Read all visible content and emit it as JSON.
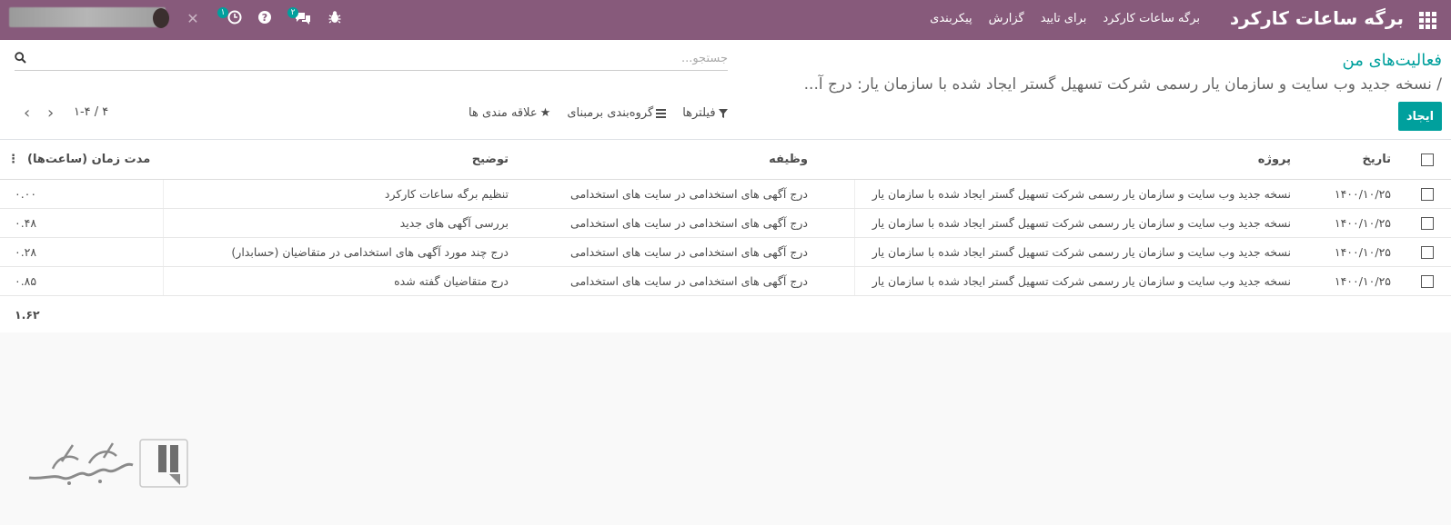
{
  "navbar": {
    "brand": "برگه ساعات کارکرد",
    "menu": [
      "برگه ساعات کارکرد",
      "برای تایید",
      "گزارش",
      "پیکربندی"
    ],
    "activity_badge": "۱",
    "messages_badge": "۲",
    "icons": [
      "apps-icon",
      "bug-icon",
      "chat-icon",
      "help-icon",
      "clock-icon",
      "close-icon"
    ]
  },
  "breadcrumb": {
    "parent": "فعالیت‌های من",
    "current": "/ نسخه جدید وب سایت و سازمان یار رسمی شرکت تسهیل گستر ایجاد شده با سازمان یار: درج آ..."
  },
  "search": {
    "placeholder": "جستجو..."
  },
  "toolbar": {
    "create": "ایجاد",
    "filters": "فیلترها",
    "groupby": "گروه‌بندی برمبنای",
    "favorites": "علاقه مندی ها"
  },
  "pager": {
    "value": "۱-۴ / ۴"
  },
  "table": {
    "columns": {
      "date": "تاریخ",
      "project": "پروژه",
      "task": "وظیفه",
      "description": "توضیح",
      "duration": "مدت زمان (ساعت‌ها)"
    },
    "rows": [
      {
        "date": "۱۴۰۰/۱۰/۲۵",
        "project": "نسخه جدید وب سایت و سازمان یار رسمی شرکت تسهیل گستر ایجاد شده با سازمان یار",
        "task": "درج آگهی های استخدامی در سایت های استخدامی",
        "description": "تنظیم برگه ساعات کارکرد",
        "duration": "۰.۰۰"
      },
      {
        "date": "۱۴۰۰/۱۰/۲۵",
        "project": "نسخه جدید وب سایت و سازمان یار رسمی شرکت تسهیل گستر ایجاد شده با سازمان یار",
        "task": "درج آگهی های استخدامی در سایت های استخدامی",
        "description": "بررسی آگهی های جدید",
        "duration": "۰.۴۸"
      },
      {
        "date": "۱۴۰۰/۱۰/۲۵",
        "project": "نسخه جدید وب سایت و سازمان یار رسمی شرکت تسهیل گستر ایجاد شده با سازمان یار",
        "task": "درج آگهی های استخدامی در سایت های استخدامی",
        "description": "درج چند مورد آگهی های استخدامی در متقاضیان (حسابدار)",
        "duration": "۰.۲۸"
      },
      {
        "date": "۱۴۰۰/۱۰/۲۵",
        "project": "نسخه جدید وب سایت و سازمان یار رسمی شرکت تسهیل گستر ایجاد شده با سازمان یار",
        "task": "درج آگهی های استخدامی در سایت های استخدامی",
        "description": "درج متقاضیان گفته شده",
        "duration": "۰.۸۵"
      }
    ],
    "total": "۱.۶۲"
  },
  "colors": {
    "navbar": "#875a7b",
    "accent": "#00a09d"
  }
}
